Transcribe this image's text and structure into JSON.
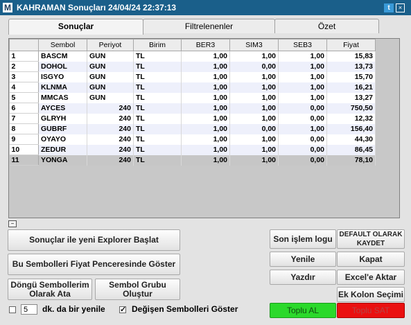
{
  "window": {
    "logo": "M",
    "title": "KAHRAMAN Sonuçları  24/04/24 22:37:13",
    "icons": [
      "twitter-icon",
      "close-icon"
    ]
  },
  "tabs": [
    {
      "label": "Sonuçlar",
      "active": true
    },
    {
      "label": "Filtrelenenler",
      "active": false
    },
    {
      "label": "Özet",
      "active": false
    }
  ],
  "table": {
    "columns": [
      "Sembol",
      "Periyot",
      "Birim",
      "BER3",
      "SIM3",
      "SEB3",
      "Fiyat"
    ],
    "rows": [
      {
        "idx": "1",
        "sembol": "BASCM",
        "periyot": "GUN",
        "birim": "TL",
        "ber3": "1,00",
        "sim3": "1,00",
        "seb3": "1,00",
        "fiyat": "15,83"
      },
      {
        "idx": "2",
        "sembol": "DOHOL",
        "periyot": "GUN",
        "birim": "TL",
        "ber3": "1,00",
        "sim3": "0,00",
        "seb3": "1,00",
        "fiyat": "13,73"
      },
      {
        "idx": "3",
        "sembol": "ISGYO",
        "periyot": "GUN",
        "birim": "TL",
        "ber3": "1,00",
        "sim3": "1,00",
        "seb3": "1,00",
        "fiyat": "15,70"
      },
      {
        "idx": "4",
        "sembol": "KLNMA",
        "periyot": "GUN",
        "birim": "TL",
        "ber3": "1,00",
        "sim3": "1,00",
        "seb3": "1,00",
        "fiyat": "16,21"
      },
      {
        "idx": "5",
        "sembol": "MMCAS",
        "periyot": "GUN",
        "birim": "TL",
        "ber3": "1,00",
        "sim3": "1,00",
        "seb3": "1,00",
        "fiyat": "13,27"
      },
      {
        "idx": "6",
        "sembol": "AYCES",
        "periyot": "240",
        "birim": "TL",
        "ber3": "1,00",
        "sim3": "1,00",
        "seb3": "0,00",
        "fiyat": "750,50"
      },
      {
        "idx": "7",
        "sembol": "GLRYH",
        "periyot": "240",
        "birim": "TL",
        "ber3": "1,00",
        "sim3": "1,00",
        "seb3": "0,00",
        "fiyat": "12,32"
      },
      {
        "idx": "8",
        "sembol": "GUBRF",
        "periyot": "240",
        "birim": "TL",
        "ber3": "1,00",
        "sim3": "0,00",
        "seb3": "1,00",
        "fiyat": "156,40"
      },
      {
        "idx": "9",
        "sembol": "OYAYO",
        "periyot": "240",
        "birim": "TL",
        "ber3": "1,00",
        "sim3": "1,00",
        "seb3": "0,00",
        "fiyat": "44,30"
      },
      {
        "idx": "10",
        "sembol": "ZEDUR",
        "periyot": "240",
        "birim": "TL",
        "ber3": "1,00",
        "sim3": "1,00",
        "seb3": "0,00",
        "fiyat": "86,45"
      },
      {
        "idx": "11",
        "sembol": "YONGA",
        "periyot": "240",
        "birim": "TL",
        "ber3": "1,00",
        "sim3": "1,00",
        "seb3": "0,00",
        "fiyat": "78,10",
        "selected": true
      }
    ]
  },
  "collapse_symbol": "−",
  "buttons": {
    "explorer": "Sonuçlar ile yeni Explorer Başlat",
    "fiyat": "Bu Sembolleri Fiyat Penceresinde Göster",
    "dongu": "Döngü Sembollerim Olarak Ata",
    "grup": "Sembol Grubu Oluştur",
    "son_islem": "Son işlem logu",
    "default": "DEFAULT OLARAK KAYDET",
    "yenile": "Yenile",
    "kapat": "Kapat",
    "yazdir": "Yazdır",
    "excel": "Excel'e Aktar",
    "ek_kolon": "Ek Kolon Seçimi",
    "toplu_al": "Toplu AL",
    "toplu_sat": "Toplu SAT"
  },
  "footer": {
    "auto_refresh_checked": false,
    "refresh_minutes": "5",
    "refresh_label": "dk. da bir yenile",
    "changed_checked": true,
    "changed_label": "Değişen Sembolleri Göster"
  },
  "colors": {
    "titlebar": "#1a5f8a",
    "buy": "#2bd92b",
    "sell": "#ea1010",
    "alt_row": "#eef0fb",
    "selected_row": "#c6c6c6"
  }
}
